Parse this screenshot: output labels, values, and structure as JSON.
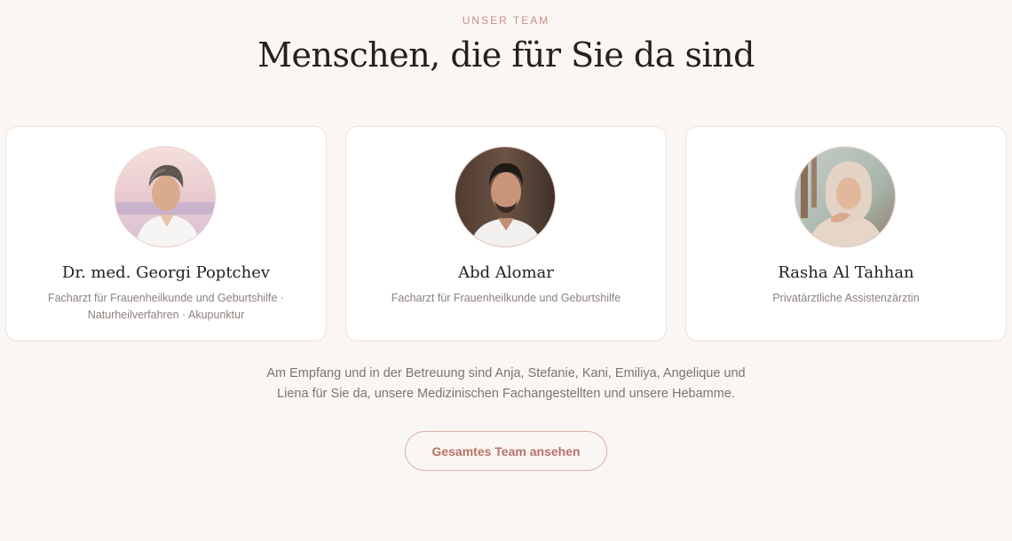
{
  "section": {
    "eyebrow": "UNSER TEAM",
    "headline": "Menschen, die für Sie da sind"
  },
  "team": [
    {
      "name": "Dr. med. Georgi Poptchev",
      "role_line1": "Facharzt für Frauenheilkunde und Geburtshilfe ·",
      "role_line2": "Naturheilverfahren · Akupunktur"
    },
    {
      "name": "Abd Alomar",
      "role_line1": "Facharzt für Frauenheilkunde und Geburtshilfe",
      "role_line2": ""
    },
    {
      "name": "Rasha Al Tahhan",
      "role_line1": "Privatärztliche Assistenzärztin",
      "role_line2": ""
    }
  ],
  "intro": {
    "line1": "Am Empfang und in der Betreuung sind Anja, Stefanie, Kani, Emiliya, Angelique und",
    "line2": "Liena für Sie da, unsere Medizinischen Fachangestellten und unsere Hebamme."
  },
  "cta": {
    "label": "Gesamtes Team ansehen"
  },
  "colors": {
    "background": "#faf6f3",
    "accent": "#c98d86",
    "button_text": "#b87268"
  }
}
